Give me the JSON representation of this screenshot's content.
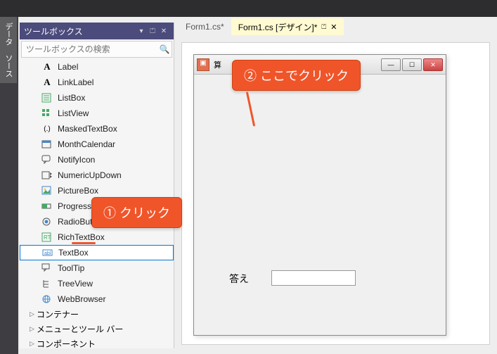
{
  "side_tab": {
    "label": "データ ソース"
  },
  "toolbox": {
    "title": "ツールボックス",
    "search_placeholder": "ツールボックスの検索",
    "items": [
      {
        "label": "Label",
        "icon": "A"
      },
      {
        "label": "LinkLabel",
        "icon": "A"
      },
      {
        "label": "ListBox",
        "icon": "list"
      },
      {
        "label": "ListView",
        "icon": "grid"
      },
      {
        "label": "MaskedTextBox",
        "icon": "mask"
      },
      {
        "label": "MonthCalendar",
        "icon": "cal"
      },
      {
        "label": "NotifyIcon",
        "icon": "chat"
      },
      {
        "label": "NumericUpDown",
        "icon": "stepper"
      },
      {
        "label": "PictureBox",
        "icon": "pic"
      },
      {
        "label": "ProgressBar",
        "icon": "bar"
      },
      {
        "label": "RadioButton",
        "icon": "radio"
      },
      {
        "label": "RichTextBox",
        "icon": "rtf"
      },
      {
        "label": "TextBox",
        "icon": "textbox",
        "selected": true
      },
      {
        "label": "ToolTip",
        "icon": "tip"
      },
      {
        "label": "TreeView",
        "icon": "tree"
      },
      {
        "label": "WebBrowser",
        "icon": "web"
      }
    ],
    "groups": [
      {
        "label": "コンテナー"
      },
      {
        "label": "メニューとツール バー"
      },
      {
        "label": "コンポーネント"
      }
    ]
  },
  "tabs": [
    {
      "label": "Form1.cs*",
      "active": false
    },
    {
      "label": "Form1.cs [デザイン]*",
      "active": true,
      "pinned": true
    }
  ],
  "form": {
    "title": "算",
    "label_text": "答え"
  },
  "callouts": {
    "c1": "① クリック",
    "c2": "② ここでクリック"
  }
}
